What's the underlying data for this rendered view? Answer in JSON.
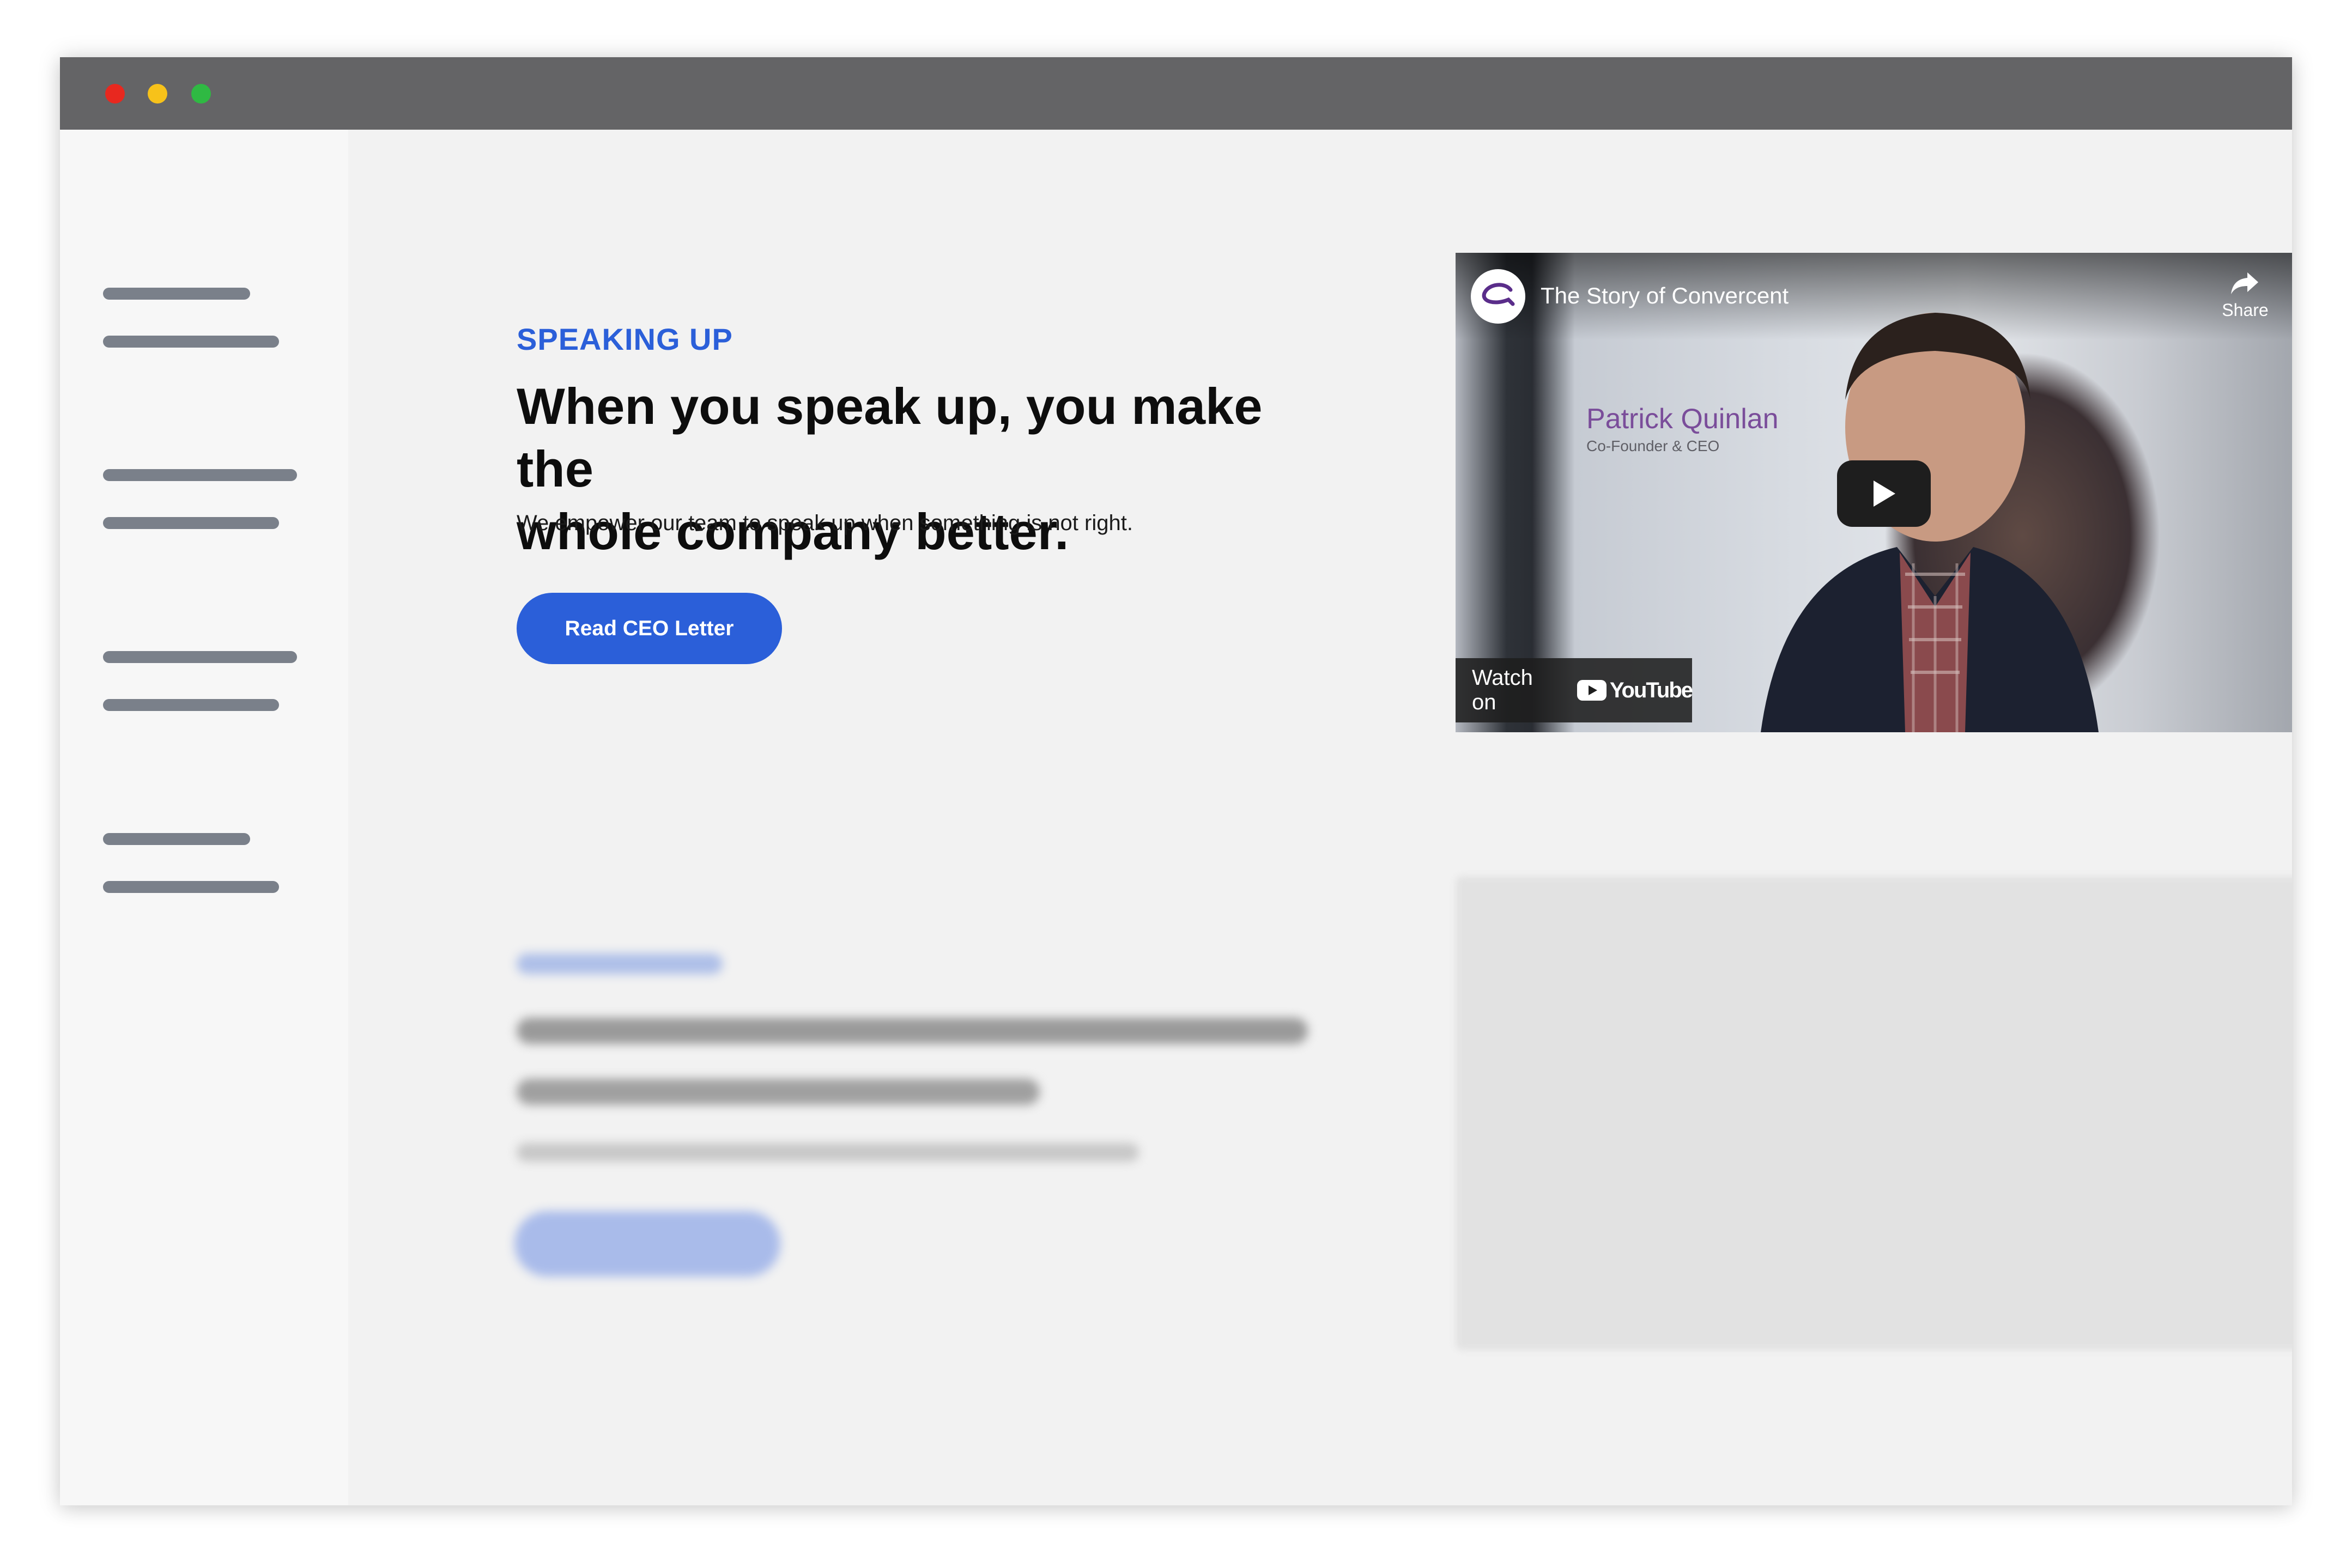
{
  "window": {
    "controls": [
      "close",
      "minimize",
      "maximize"
    ]
  },
  "hero": {
    "eyebrow": "SPEAKING UP",
    "headline_line1": "When you speak up, you make the",
    "headline_line2": "whole company better.",
    "subtext": "We empower our team to speak up when something is not right.",
    "cta_label": "Read CEO Letter"
  },
  "video": {
    "title": "The Story of Convercent",
    "share_label": "Share",
    "person_name": "Patrick Quinlan",
    "person_role": "Co-Founder & CEO",
    "watch_on_label": "Watch on",
    "platform_label": "YouTube",
    "play_icon": "play-icon",
    "share_icon": "share-arrow-icon"
  },
  "colors": {
    "accent": "#2b5fd9",
    "titlebar": "#646466",
    "sidebar_bars": "#7a808a"
  }
}
